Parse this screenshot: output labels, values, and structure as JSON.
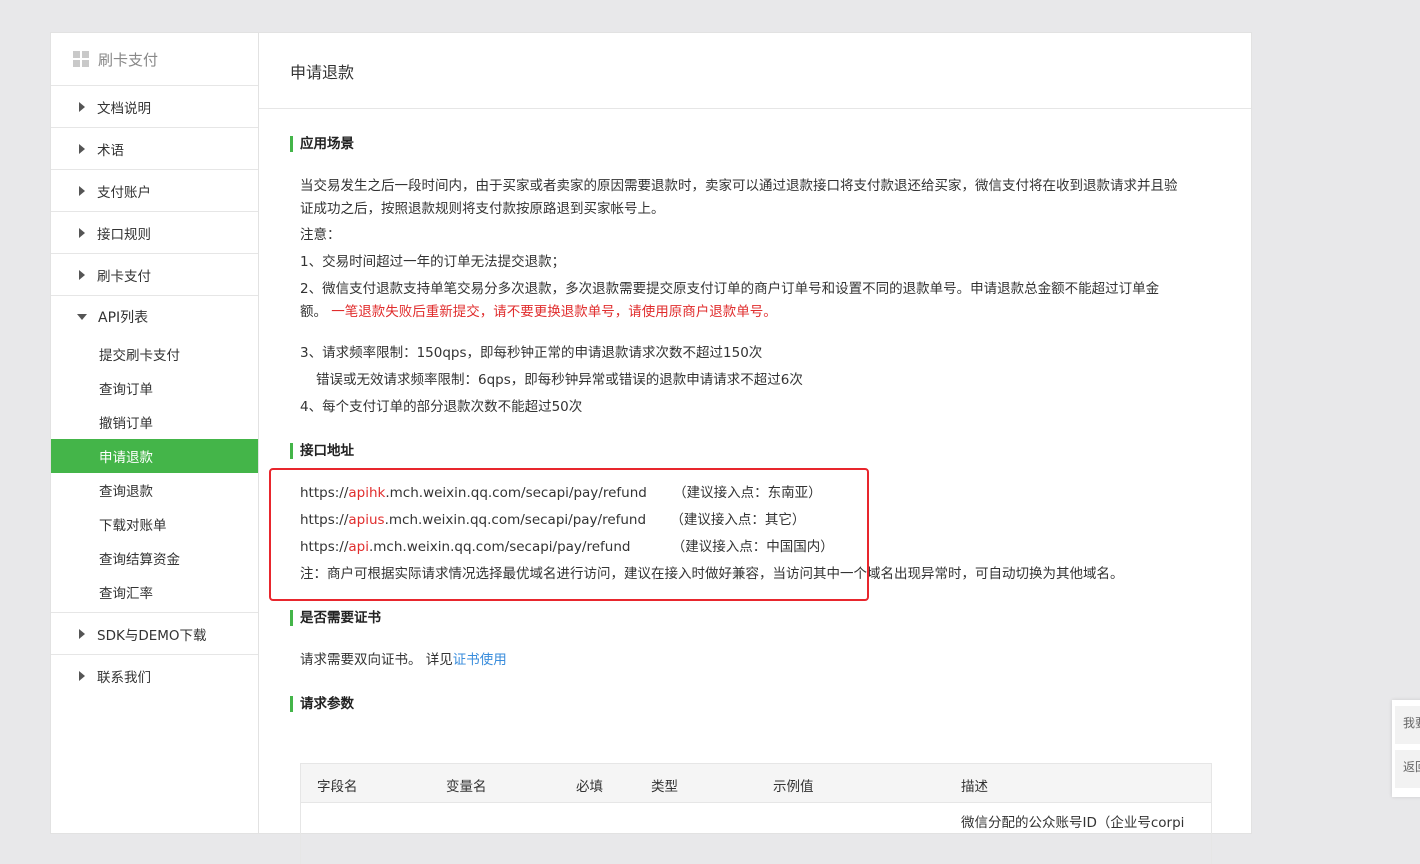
{
  "sidebar": {
    "header": "刷卡支付",
    "items": [
      {
        "label": "文档说明"
      },
      {
        "label": "术语"
      },
      {
        "label": "支付账户"
      },
      {
        "label": "接口规则"
      },
      {
        "label": "刷卡支付"
      }
    ],
    "api_group": {
      "label": "API列表",
      "children": [
        {
          "label": "提交刷卡支付"
        },
        {
          "label": "查询订单"
        },
        {
          "label": "撤销订单"
        },
        {
          "label": "申请退款"
        },
        {
          "label": "查询退款"
        },
        {
          "label": "下载对账单"
        },
        {
          "label": "查询结算资金"
        },
        {
          "label": "查询汇率"
        }
      ]
    },
    "tail_items": [
      {
        "label": "SDK与DEMO下载"
      },
      {
        "label": "联系我们"
      }
    ]
  },
  "page": {
    "title": "申请退款",
    "scene": {
      "title": "应用场景",
      "p1_l1": "当交易发生之后一段时间内，由于买家或者卖家的原因需要退款时，卖家可以通过退款接口将支付款退还给买家，微信支付将在收到退款请求并且验",
      "p1_l2": "证成功之后，按照退款规则将支付款按原路退到买家帐号上。",
      "note": "注意：",
      "n1": "1、交易时间超过一年的订单无法提交退款；",
      "n2_l1": "2、微信支付退款支持单笔交易分多次退款，多次退款需要提交原支付订单的商户订单号和设置不同的退款单号。申请退款总金额不能超过订单金",
      "n2_l2a": "额。",
      "n2_l2b": "一笔退款失败后重新提交，请不要更换退款单号，请使用原商户退款单号。",
      "n3": "3、请求频率限制：150qps，即每秒钟正常的申请退款请求次数不超过150次",
      "n3b": "错误或无效请求频率限制：6qps，即每秒钟异常或错误的退款申请请求不超过6次",
      "n4": "4、每个支付订单的部分退款次数不能超过50次"
    },
    "endpoint": {
      "title": "接口地址",
      "urls": [
        {
          "prefix": "https://",
          "host": "apihk",
          "path": ".mch.weixin.qq.com/secapi/pay/refund",
          "note": "（建议接入点：东南亚）"
        },
        {
          "prefix": "https://",
          "host": "apius",
          "path": ".mch.weixin.qq.com/secapi/pay/refund",
          "note": "（建议接入点：其它）"
        },
        {
          "prefix": "https://",
          "host": "api",
          "path": ".mch.weixin.qq.com/secapi/pay/refund",
          "note": "（建议接入点：中国国内）"
        }
      ],
      "footnote": "注：商户可根据实际请求情况选择最优域名进行访问，建议在接入时做好兼容，当访问其中一个域名出现异常时，可自动切换为其他域名。"
    },
    "cert": {
      "title": "是否需要证书",
      "text": "请求需要双向证书。 详见",
      "link": "证书使用"
    },
    "params": {
      "title": "请求参数",
      "headers": [
        "字段名",
        "变量名",
        "必填",
        "类型",
        "示例值",
        "描述"
      ],
      "row_desc": "微信分配的公众账号ID（企业号corpi"
    }
  },
  "float": {
    "btn1": "我要",
    "btn2": "返回"
  }
}
